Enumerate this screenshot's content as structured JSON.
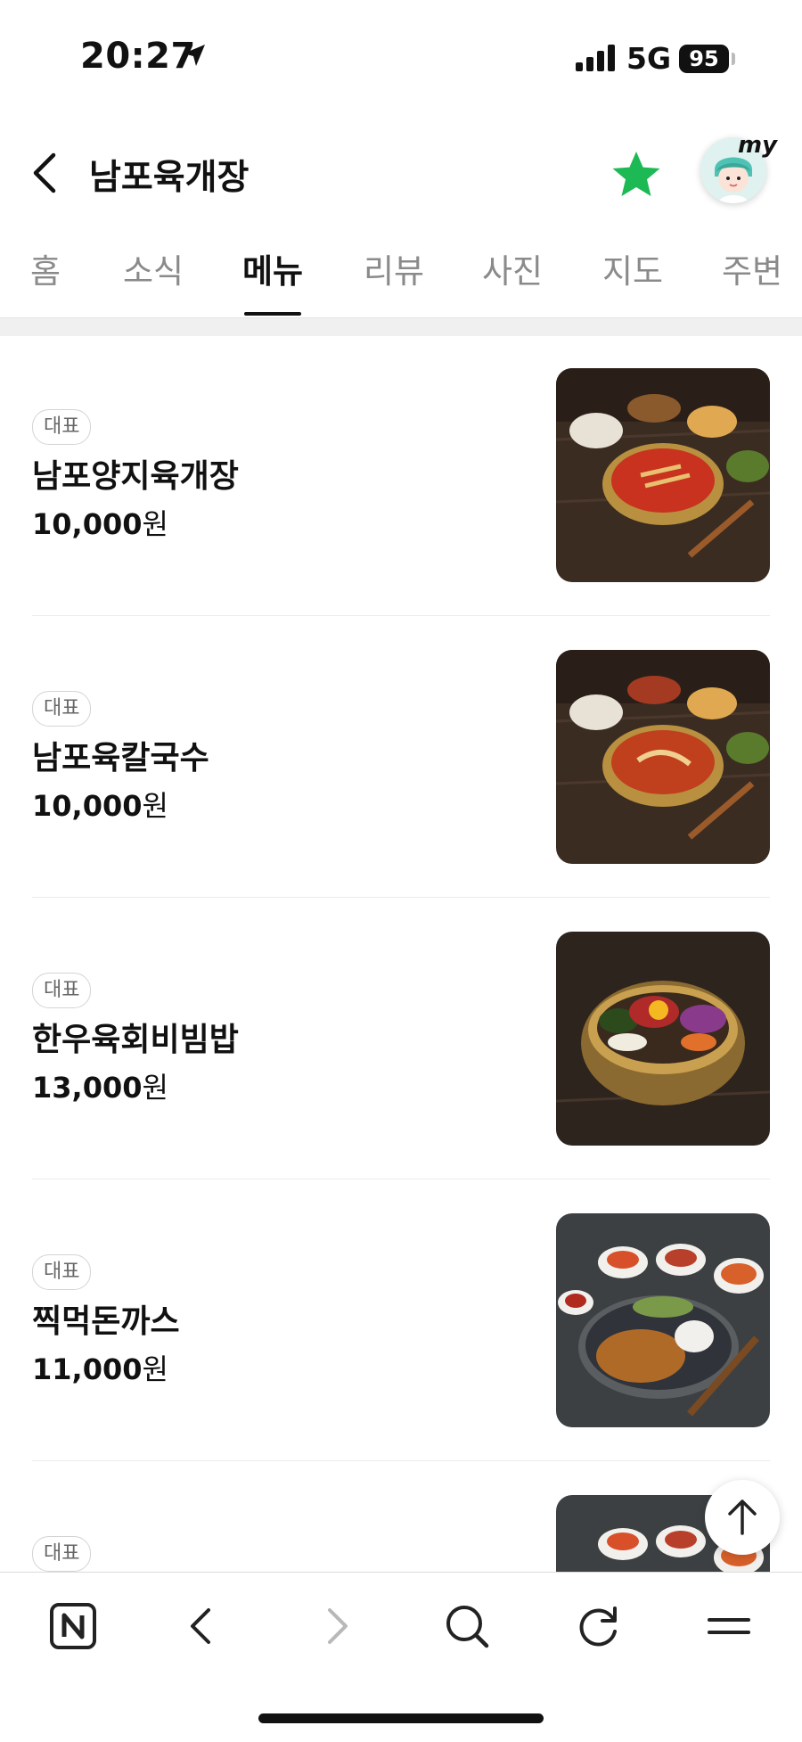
{
  "status": {
    "time": "20:27",
    "network": "5G",
    "battery": "95"
  },
  "header": {
    "title": "남포육개장",
    "avatar_label": "my"
  },
  "tabs": [
    {
      "label": "홈"
    },
    {
      "label": "소식"
    },
    {
      "label": "메뉴",
      "active": true
    },
    {
      "label": "리뷰"
    },
    {
      "label": "사진"
    },
    {
      "label": "지도"
    },
    {
      "label": "주변"
    }
  ],
  "menu": [
    {
      "badge": "대표",
      "name": "남포양지육개장",
      "price": "10,000",
      "unit": "원"
    },
    {
      "badge": "대표",
      "name": "남포육칼국수",
      "price": "10,000",
      "unit": "원"
    },
    {
      "badge": "대표",
      "name": "한우육회비빔밥",
      "price": "13,000",
      "unit": "원"
    },
    {
      "badge": "대표",
      "name": "찍먹돈까스",
      "price": "11,000",
      "unit": "원"
    },
    {
      "badge": "대표",
      "name": "",
      "price": "",
      "unit": ""
    }
  ],
  "colors": {
    "accent_star": "#1db954",
    "text": "#111111",
    "muted": "#8a8a8a"
  },
  "icons": {
    "back": "chevron-left-icon",
    "favorite": "star-icon",
    "scroll_top": "arrow-up-icon",
    "bottom_bar": [
      "naver-home-icon",
      "back-icon",
      "forward-icon",
      "search-icon",
      "reload-icon",
      "menu-icon"
    ]
  }
}
